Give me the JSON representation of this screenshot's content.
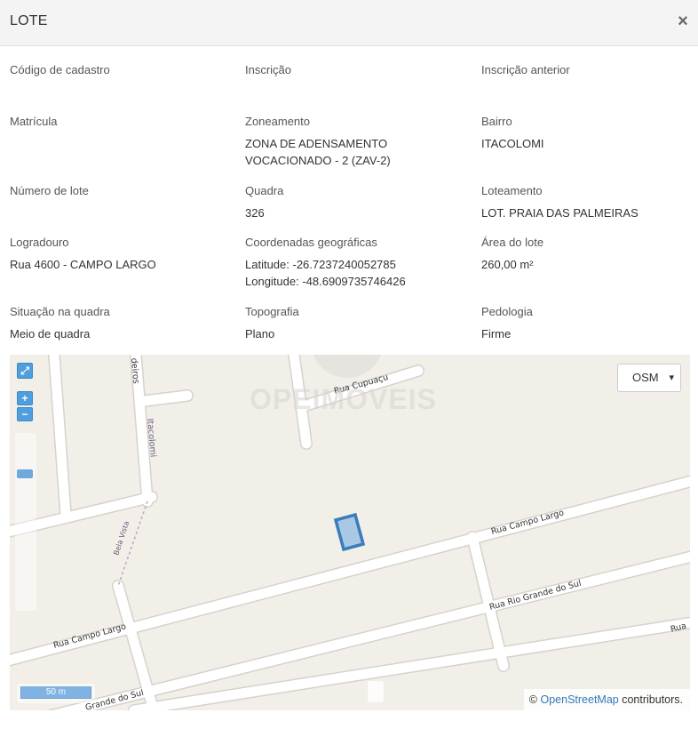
{
  "modal": {
    "title": "LOTE",
    "close_glyph": "×"
  },
  "fields": {
    "codigo_cadastro": {
      "label": "Código de cadastro",
      "value": ""
    },
    "inscricao": {
      "label": "Inscrição",
      "value": ""
    },
    "inscricao_anterior": {
      "label": "Inscrição anterior",
      "value": ""
    },
    "matricula": {
      "label": "Matrícula",
      "value": ""
    },
    "zoneamento": {
      "label": "Zoneamento",
      "value": "ZONA DE ADENSAMENTO\nVOCACIONADO - 2 (ZAV-2)"
    },
    "bairro": {
      "label": "Bairro",
      "value": "ITACOLOMI"
    },
    "numero_lote": {
      "label": "Número de lote",
      "value": ""
    },
    "quadra": {
      "label": "Quadra",
      "value": "326"
    },
    "loteamento": {
      "label": "Loteamento",
      "value": "LOT. PRAIA DAS PALMEIRAS"
    },
    "logradouro": {
      "label": "Logradouro",
      "value": "Rua 4600 - CAMPO LARGO"
    },
    "coordenadas": {
      "label": "Coordenadas geográficas",
      "value": "Latitude: -26.7237240052785\nLongitude: -48.6909735746426"
    },
    "area_lote": {
      "label": "Área do lote",
      "value": "260,00 m²"
    },
    "situacao_quadra": {
      "label": "Situação na quadra",
      "value": "Meio de quadra"
    },
    "topografia": {
      "label": "Topografia",
      "value": "Plano"
    },
    "pedologia": {
      "label": "Pedologia",
      "value": "Firme"
    }
  },
  "map": {
    "layer_selected": "OSM",
    "zoom_in": "+",
    "zoom_out": "−",
    "fullscreen_icon": "expand-icon",
    "scale_label": "50 m",
    "watermark": "OPEIMOVEIS",
    "attribution_prefix": "©",
    "attribution_link": "OpenStreetMap",
    "attribution_suffix": "contributors.",
    "street_labels": {
      "rua_cupuacu": "Rua Cupuaçu",
      "rua_campo_largo_right": "Rua Campo Largo",
      "rua_campo_largo_left": "Rua Campo Largo",
      "rua_rio_grande_right": "Rua Rio Grande do Sul",
      "rua_rio_grande_left": "Grande do Sul",
      "itacolomi": "Itacolomi",
      "bela_vista": "Bela Vista",
      "top_left_fragment": "deiros",
      "right_fragment": "Rua"
    },
    "colors": {
      "lot_fill": "#a9c8e4",
      "lot_stroke": "#3a7dbd",
      "background": "#f2efe9",
      "roads": "#ffffff"
    }
  }
}
